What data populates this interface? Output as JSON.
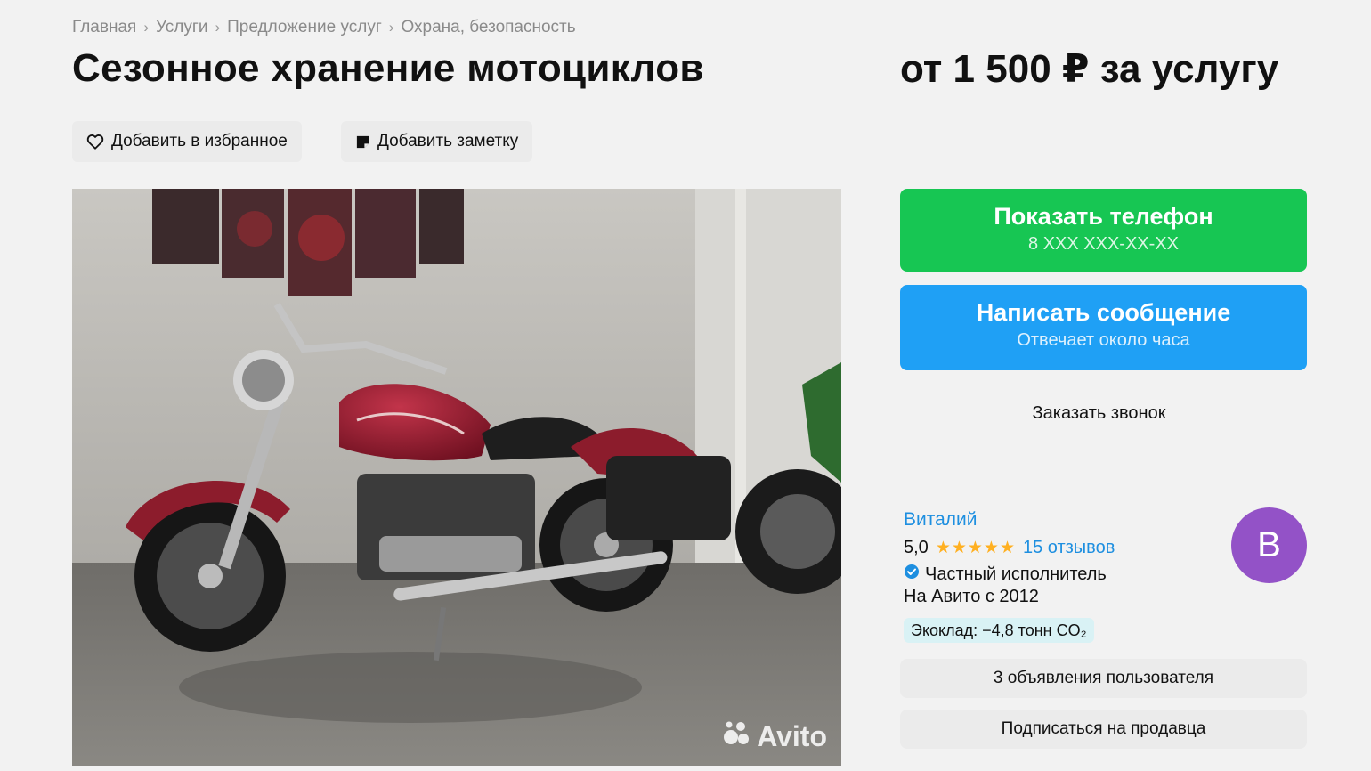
{
  "breadcrumb": {
    "items": [
      "Главная",
      "Услуги",
      "Предложение услуг",
      "Охрана, безопасность"
    ],
    "separator": "›"
  },
  "listing": {
    "title": "Сезонное хранение мотоциклов",
    "price": "от 1 500 ₽ за услугу"
  },
  "actions": {
    "favorite": "Добавить в избранное",
    "note": "Добавить заметку"
  },
  "photo": {
    "watermark": "Avito"
  },
  "contact": {
    "phone_label": "Показать телефон",
    "phone_masked": "8 XXX XXX-XX-XX",
    "message_label": "Написать сообщение",
    "message_sub": "Отвечает около часа",
    "callback": "Заказать звонок"
  },
  "seller": {
    "name": "Виталий",
    "rating": "5,0",
    "stars": "★★★★★",
    "reviews": "15 отзывов",
    "type": "Частный исполнитель",
    "since": "На Авито с 2012",
    "eco": "Экоклад: −4,8 тонн CO₂",
    "avatar_letter": "В",
    "avatar_color": "#9352c7",
    "ads_link": "3 объявления пользователя",
    "subscribe": "Подписаться на продавца"
  },
  "colors": {
    "phone_button": "#17c653",
    "message_button": "#1fa0f5",
    "link": "#1e8fe0",
    "star": "#ffb021"
  }
}
